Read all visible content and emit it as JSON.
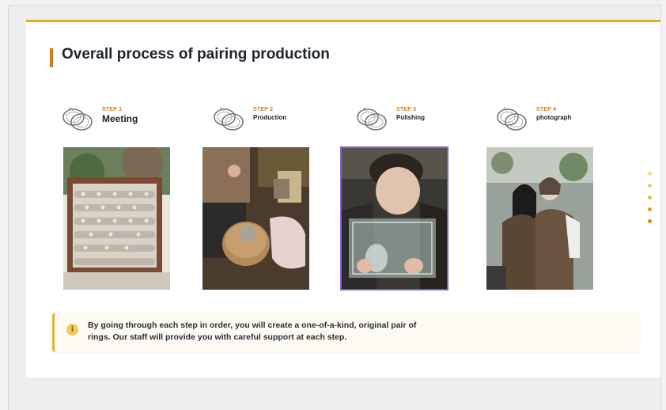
{
  "page": {
    "title": "Overall process of pairing production"
  },
  "steps": [
    {
      "label": "STEP 1",
      "name": "Meeting",
      "icon": "ring-pair-icon",
      "photo": "ring-display-tray-photo"
    },
    {
      "label": "STEP 2",
      "name": "Production",
      "icon": "ring-pair-icon",
      "photo": "ring-production-workbench-photo"
    },
    {
      "label": "STEP 3",
      "name": "Polishing",
      "icon": "ring-pair-icon",
      "photo": "ring-polishing-photo"
    },
    {
      "label": "STEP 4",
      "name": "photograph",
      "icon": "ring-pair-icon",
      "photo": "couple-photograph-photo"
    }
  ],
  "carousel": {
    "dot_colors": [
      "#f7d88a",
      "#f2c65b",
      "#eeb540",
      "#e49d2a",
      "#d98420"
    ]
  },
  "note": {
    "icon": "info-icon",
    "text": "By going through each step in order, you will create a one-of-a-kind, original pair of rings. Our staff will provide you with careful support at each step."
  },
  "colors": {
    "accent": "#e2ac27",
    "title_marker": "#d57a1e",
    "step_label": "#d27d26",
    "selected_outline": "#8a5ad9"
  }
}
